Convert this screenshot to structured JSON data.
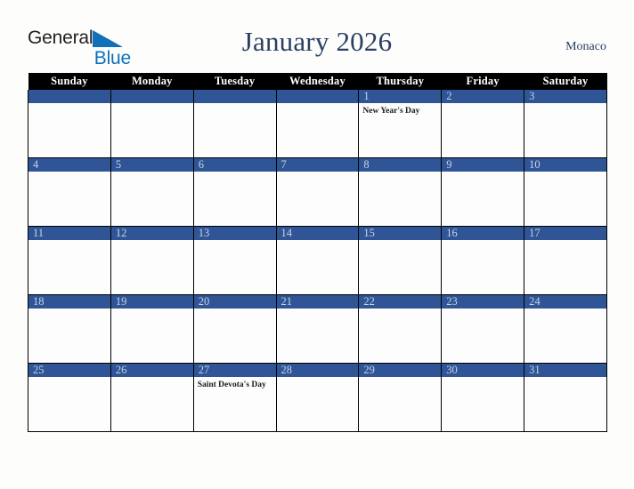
{
  "brand": {
    "logo_text_primary": "General",
    "logo_text_secondary": "Blue",
    "logo_triangle_icon": "blue-right-triangle-icon",
    "primary_color": "#231f20",
    "secondary_color": "#0d72bb"
  },
  "header": {
    "title": "January 2026",
    "country": "Monaco",
    "title_color": "#2b3f63"
  },
  "calendar": {
    "month": "January",
    "year": "2026",
    "accent_color": "#2f5597",
    "header_bg_color": "#000000",
    "daynum_color": "#c9d3e3",
    "weekday_headers": [
      "Sunday",
      "Monday",
      "Tuesday",
      "Wednesday",
      "Thursday",
      "Friday",
      "Saturday"
    ],
    "weeks": [
      [
        {
          "day": "",
          "event": ""
        },
        {
          "day": "",
          "event": ""
        },
        {
          "day": "",
          "event": ""
        },
        {
          "day": "",
          "event": ""
        },
        {
          "day": "1",
          "event": "New Year's Day"
        },
        {
          "day": "2",
          "event": ""
        },
        {
          "day": "3",
          "event": ""
        }
      ],
      [
        {
          "day": "4",
          "event": ""
        },
        {
          "day": "5",
          "event": ""
        },
        {
          "day": "6",
          "event": ""
        },
        {
          "day": "7",
          "event": ""
        },
        {
          "day": "8",
          "event": ""
        },
        {
          "day": "9",
          "event": ""
        },
        {
          "day": "10",
          "event": ""
        }
      ],
      [
        {
          "day": "11",
          "event": ""
        },
        {
          "day": "12",
          "event": ""
        },
        {
          "day": "13",
          "event": ""
        },
        {
          "day": "14",
          "event": ""
        },
        {
          "day": "15",
          "event": ""
        },
        {
          "day": "16",
          "event": ""
        },
        {
          "day": "17",
          "event": ""
        }
      ],
      [
        {
          "day": "18",
          "event": ""
        },
        {
          "day": "19",
          "event": ""
        },
        {
          "day": "20",
          "event": ""
        },
        {
          "day": "21",
          "event": ""
        },
        {
          "day": "22",
          "event": ""
        },
        {
          "day": "23",
          "event": ""
        },
        {
          "day": "24",
          "event": ""
        }
      ],
      [
        {
          "day": "25",
          "event": ""
        },
        {
          "day": "26",
          "event": ""
        },
        {
          "day": "27",
          "event": "Saint Devota's Day"
        },
        {
          "day": "28",
          "event": ""
        },
        {
          "day": "29",
          "event": ""
        },
        {
          "day": "30",
          "event": ""
        },
        {
          "day": "31",
          "event": ""
        }
      ]
    ]
  }
}
